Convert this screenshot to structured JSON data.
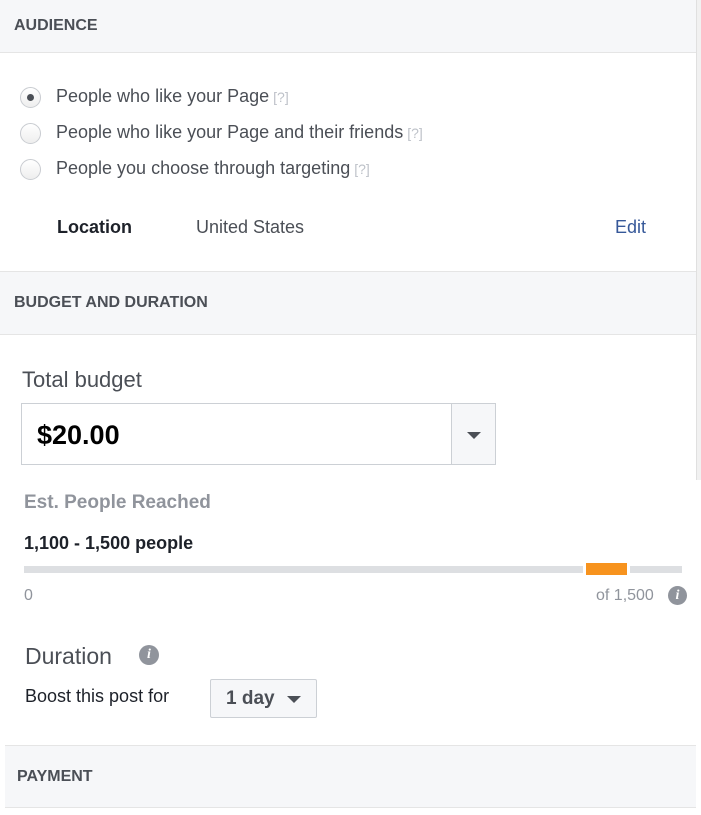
{
  "audience": {
    "title": "AUDIENCE",
    "options": [
      {
        "label": "People who like your Page",
        "help": "[?]",
        "selected": true
      },
      {
        "label": "People who like your Page and their friends",
        "help": "[?]",
        "selected": false
      },
      {
        "label": "People you choose through targeting",
        "help": "[?]",
        "selected": false
      }
    ],
    "location_label": "Location",
    "location_value": "United States",
    "edit_label": "Edit"
  },
  "budget": {
    "title": "BUDGET AND DURATION",
    "total_label": "Total budget",
    "total_value": "$20.00",
    "reach_label": "Est. People Reached",
    "reach_value": "1,100 - 1,500 people",
    "reach_min": "0",
    "reach_max": "of 1,500",
    "reach_range": [
      1100,
      1500
    ],
    "reach_scale_max": 1500,
    "accent": "#f7931e",
    "duration_label": "Duration",
    "boost_label": "Boost this post for",
    "boost_value": "1 day"
  },
  "payment": {
    "title": "PAYMENT"
  },
  "colors": {
    "link": "#365899",
    "header_bg": "#f6f7f9"
  }
}
